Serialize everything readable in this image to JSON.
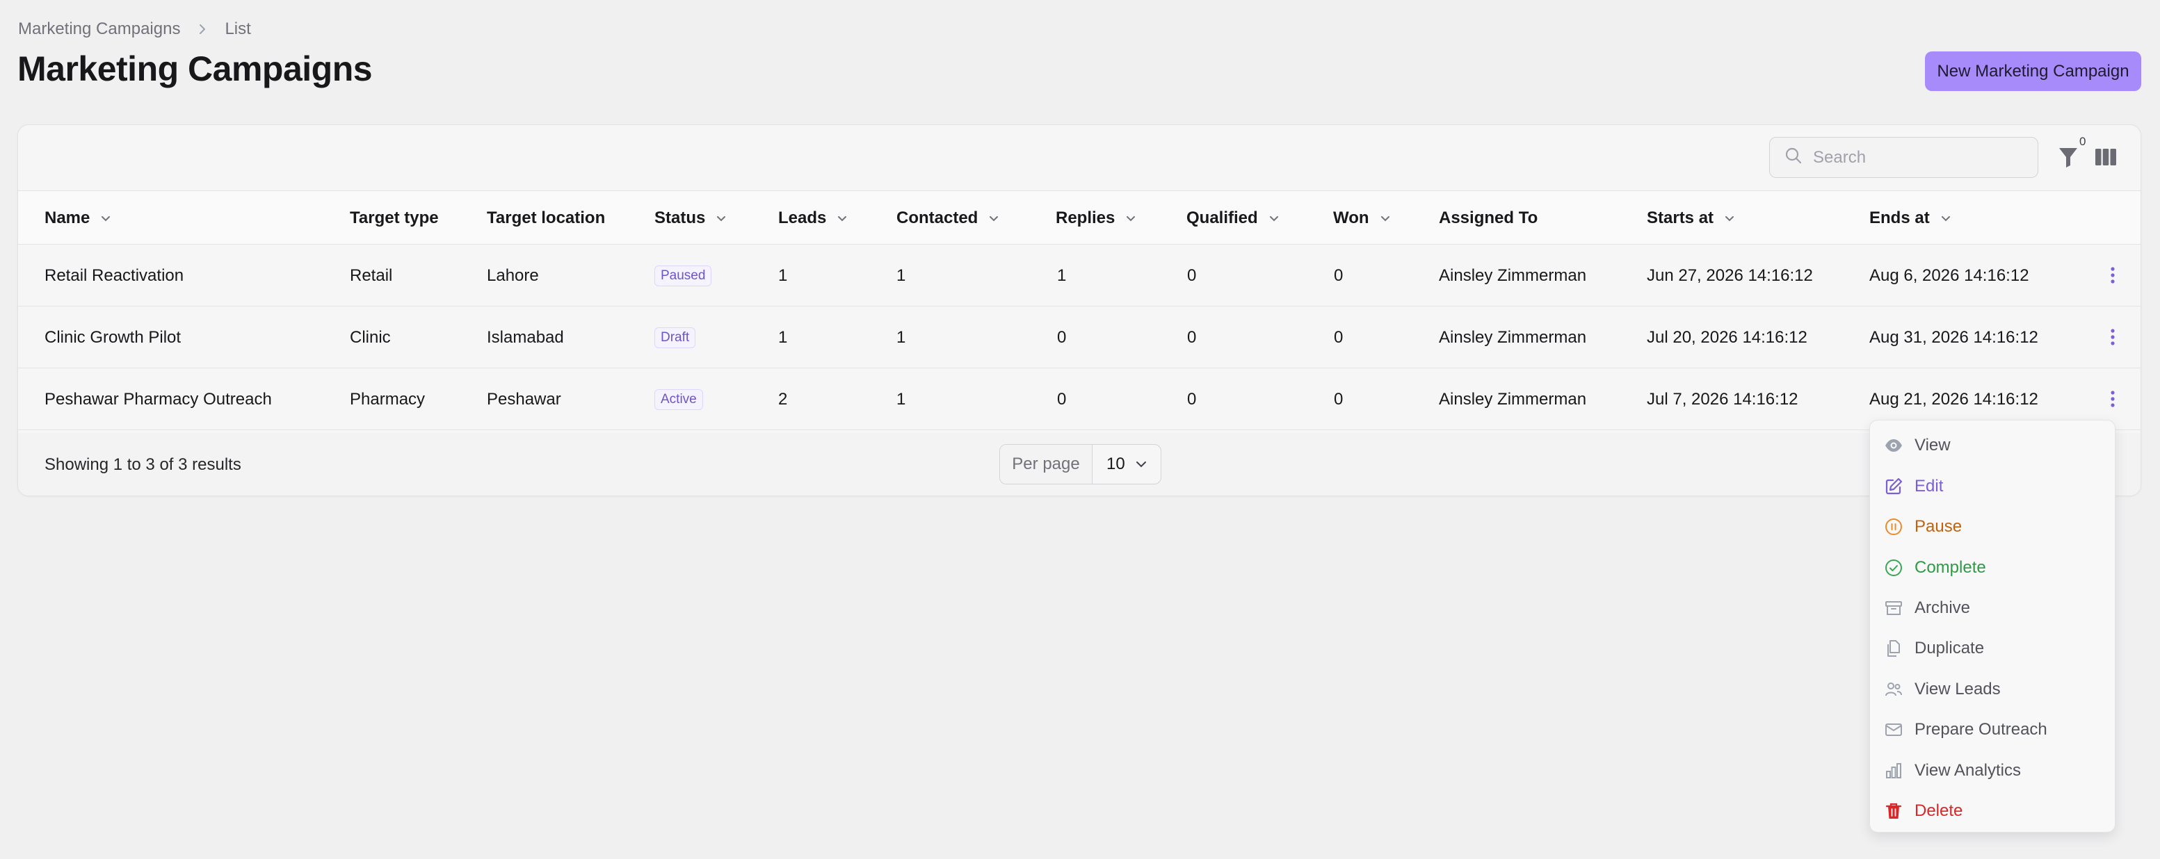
{
  "breadcrumb": {
    "parent": "Marketing Campaigns",
    "current": "List"
  },
  "page_title": "Marketing Campaigns",
  "new_button": "New Marketing Campaign",
  "toolbar": {
    "search_placeholder": "Search",
    "filter_count": "0"
  },
  "columns": [
    "Name",
    "Target type",
    "Target location",
    "Status",
    "Leads",
    "Contacted",
    "Replies",
    "Qualified",
    "Won",
    "Assigned To",
    "Starts at",
    "Ends at"
  ],
  "rows": [
    {
      "name": "Retail Reactivation",
      "target_type": "Retail",
      "target_location": "Lahore",
      "status": "Paused",
      "leads": "1",
      "contacted": "1",
      "replies": "1",
      "qualified": "0",
      "won": "0",
      "assigned_to": "Ainsley Zimmerman",
      "starts_at": "Jun 27, 2026 14:16:12",
      "ends_at": "Aug 6, 2026 14:16:12"
    },
    {
      "name": "Clinic Growth Pilot",
      "target_type": "Clinic",
      "target_location": "Islamabad",
      "status": "Draft",
      "leads": "1",
      "contacted": "1",
      "replies": "0",
      "qualified": "0",
      "won": "0",
      "assigned_to": "Ainsley Zimmerman",
      "starts_at": "Jul 20, 2026 14:16:12",
      "ends_at": "Aug 31, 2026 14:16:12"
    },
    {
      "name": "Peshawar Pharmacy Outreach",
      "target_type": "Pharmacy",
      "target_location": "Peshawar",
      "status": "Active",
      "leads": "2",
      "contacted": "1",
      "replies": "0",
      "qualified": "0",
      "won": "0",
      "assigned_to": "Ainsley Zimmerman",
      "starts_at": "Jul 7, 2026 14:16:12",
      "ends_at": "Aug 21, 2026 14:16:12"
    }
  ],
  "footer": {
    "results_text": "Showing 1 to 3 of 3 results",
    "per_page_label": "Per page",
    "per_page_value": "10"
  },
  "menu": {
    "view": "View",
    "edit": "Edit",
    "pause": "Pause",
    "complete": "Complete",
    "archive": "Archive",
    "duplicate": "Duplicate",
    "view_leads": "View Leads",
    "prepare_outreach": "Prepare Outreach",
    "view_analytics": "View Analytics",
    "delete": "Delete"
  },
  "colors": {
    "primary": "#a78bfa",
    "edit": "#7c5fd6",
    "pause": "#c2620c",
    "complete": "#2f9a45",
    "delete": "#dc2626",
    "neutral": "#52525b"
  }
}
